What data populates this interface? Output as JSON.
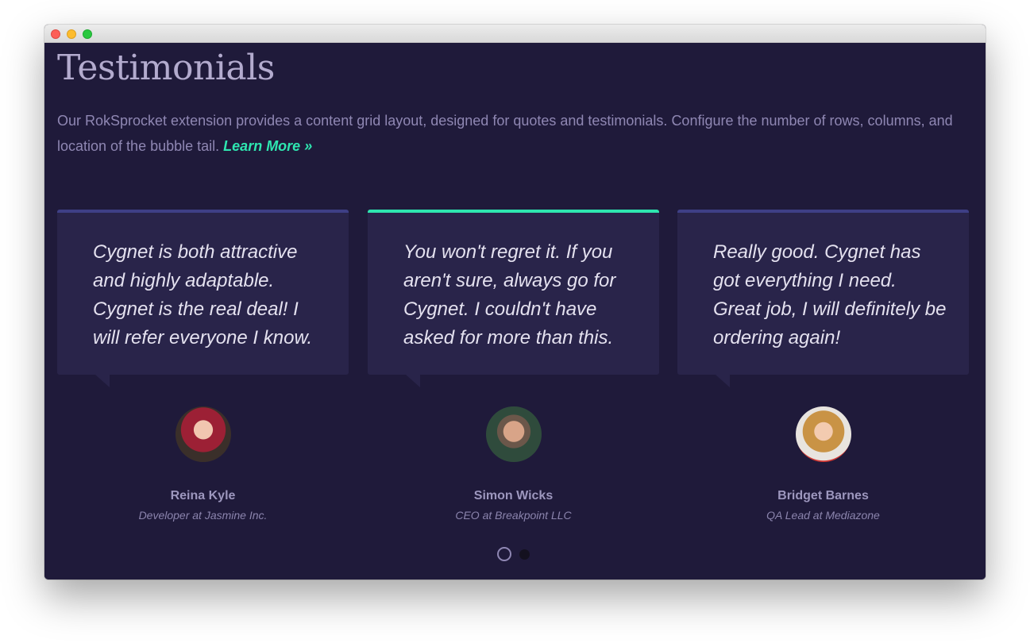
{
  "page": {
    "title": "Testimonials",
    "intro_text": "Our RokSprocket extension provides a content grid layout, designed for quotes and testimonials. Configure the number of rows, columns, and location of the bubble tail.",
    "learn_more_label": "Learn More",
    "learn_more_icon": "»"
  },
  "colors": {
    "background": "#1f1a3a",
    "card": "#29244a",
    "accent": "#2ee6b0",
    "card_border": "#3e3f86"
  },
  "testimonials": [
    {
      "quote": "Cygnet is both attractive and highly adaptable. Cygnet is the real deal! I will refer everyone I know.",
      "name": "Reina Kyle",
      "role": "Developer at Jasmine Inc.",
      "active": false
    },
    {
      "quote": "You won't regret it. If you aren't sure, always go for Cygnet. I couldn't have asked for more than this.",
      "name": "Simon Wicks",
      "role": "CEO at Breakpoint LLC",
      "active": true
    },
    {
      "quote": "Really good. Cygnet has got everything I need. Great job, I will definitely be ordering again!",
      "name": "Bridget Barnes",
      "role": "QA Lead at Mediazone",
      "active": false
    }
  ],
  "pager": {
    "total": 2,
    "current": 1
  }
}
